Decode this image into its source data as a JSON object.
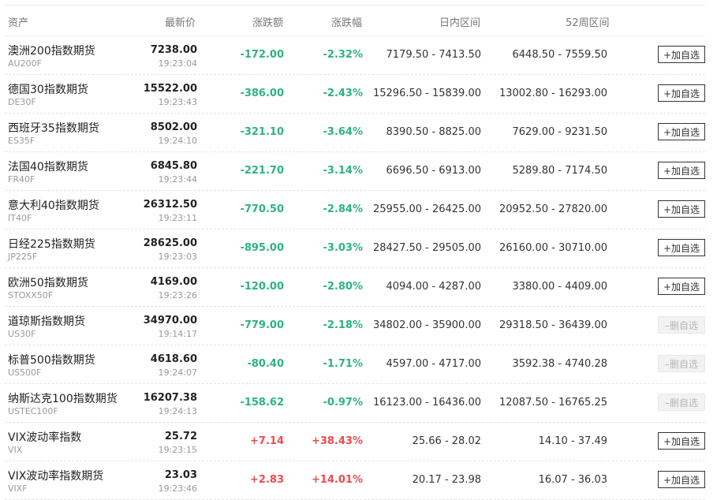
{
  "header": {
    "asset": "资产",
    "latest": "最新价",
    "change": "涨跌额",
    "pct": "涨跌幅",
    "day_range": "日内区间",
    "week52_range": "52周区间"
  },
  "rows": [
    {
      "name": "澳洲200指数期货",
      "code": "AU200F",
      "price": "7238.00",
      "time": "19:23:04",
      "change": "-172.00",
      "pct": "-2.32%",
      "dir": "down",
      "day": "7179.50 - 7413.50",
      "wk": "6448.50 - 7559.50",
      "action": "+加自选",
      "in_watchlist": false
    },
    {
      "name": "德国30指数期货",
      "code": "DE30F",
      "price": "15522.00",
      "time": "19:23:43",
      "change": "-386.00",
      "pct": "-2.43%",
      "dir": "down",
      "day": "15296.50 - 15839.00",
      "wk": "13002.80 - 16293.00",
      "action": "+加自选",
      "in_watchlist": false
    },
    {
      "name": "西班牙35指数期货",
      "code": "ES35F",
      "price": "8502.00",
      "time": "19:24:10",
      "change": "-321.10",
      "pct": "-3.64%",
      "dir": "down",
      "day": "8390.50 - 8825.00",
      "wk": "7629.00 - 9231.50",
      "action": "+加自选",
      "in_watchlist": false
    },
    {
      "name": "法国40指数期货",
      "code": "FR40F",
      "price": "6845.80",
      "time": "19:23:44",
      "change": "-221.70",
      "pct": "-3.14%",
      "dir": "down",
      "day": "6696.50 - 6913.00",
      "wk": "5289.80 - 7174.50",
      "action": "+加自选",
      "in_watchlist": false
    },
    {
      "name": "意大利40指数期货",
      "code": "IT40F",
      "price": "26312.50",
      "time": "19:23:11",
      "change": "-770.50",
      "pct": "-2.84%",
      "dir": "down",
      "day": "25955.00 - 26425.00",
      "wk": "20952.50 - 27820.00",
      "action": "+加自选",
      "in_watchlist": false
    },
    {
      "name": "日经225指数期货",
      "code": "JP225F",
      "price": "28625.00",
      "time": "19:23:03",
      "change": "-895.00",
      "pct": "-3.03%",
      "dir": "down",
      "day": "28427.50 - 29505.00",
      "wk": "26160.00 - 30710.00",
      "action": "+加自选",
      "in_watchlist": false
    },
    {
      "name": "欧洲50指数期货",
      "code": "STOXX50F",
      "price": "4169.00",
      "time": "19:23:26",
      "change": "-120.00",
      "pct": "-2.80%",
      "dir": "down",
      "day": "4094.00 - 4287.00",
      "wk": "3380.00 - 4409.00",
      "action": "+加自选",
      "in_watchlist": false
    },
    {
      "name": "道琼斯指数期货",
      "code": "US30F",
      "price": "34970.00",
      "time": "19:14:17",
      "change": "-779.00",
      "pct": "-2.18%",
      "dir": "down",
      "day": "34802.00 - 35900.00",
      "wk": "29318.50 - 36439.00",
      "action": "–删自选",
      "in_watchlist": true
    },
    {
      "name": "标普500指数期货",
      "code": "US500F",
      "price": "4618.60",
      "time": "19:24:07",
      "change": "-80.40",
      "pct": "-1.71%",
      "dir": "down",
      "day": "4597.00 - 4717.00",
      "wk": "3592.38 - 4740.28",
      "action": "–删自选",
      "in_watchlist": true
    },
    {
      "name": "纳斯达克100指数期货",
      "code": "USTEC100F",
      "price": "16207.38",
      "time": "19:24:13",
      "change": "-158.62",
      "pct": "-0.97%",
      "dir": "down",
      "day": "16123.00 - 16436.00",
      "wk": "12087.50 - 16765.25",
      "action": "–删自选",
      "in_watchlist": true
    },
    {
      "name": "VIX波动率指数",
      "code": "VIX",
      "price": "25.72",
      "time": "19:23:15",
      "change": "+7.14",
      "pct": "+38.43%",
      "dir": "up",
      "day": "25.66 - 28.02",
      "wk": "14.10 - 37.49",
      "action": "+加自选",
      "in_watchlist": false
    },
    {
      "name": "VIX波动率指数期货",
      "code": "VIXF",
      "price": "23.03",
      "time": "19:23:46",
      "change": "+2.83",
      "pct": "+14.01%",
      "dir": "up",
      "day": "20.17 - 23.98",
      "wk": "16.07 - 36.03",
      "action": "+加自选",
      "in_watchlist": false
    }
  ],
  "colors": {
    "down": "#2db47d",
    "up": "#f0494f"
  }
}
